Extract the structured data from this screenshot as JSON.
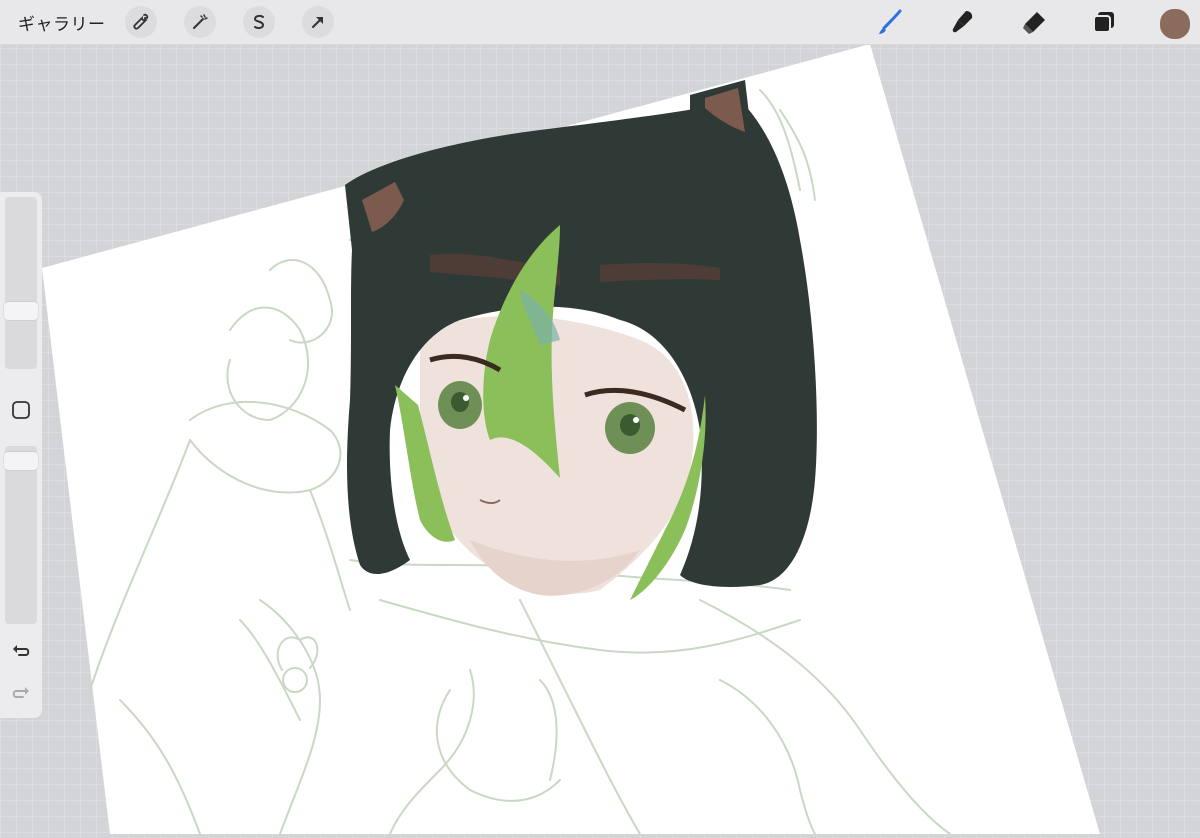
{
  "topbar": {
    "gallery_label": "ギャラリー",
    "left_tools": [
      "wrench-icon",
      "magic-wand-icon",
      "selection-s-icon",
      "arrow-transform-icon"
    ],
    "right_tools": [
      "brush-icon",
      "smudge-icon",
      "eraser-icon",
      "layers-icon"
    ],
    "accent": "#2f6fe0",
    "current_color": "#8b6b5c"
  },
  "sidebar": {
    "brush_size_level": 0.78,
    "opacity_level": 0.05,
    "modify_button": "square-icon",
    "undo": "undo-icon",
    "redo": "redo-icon"
  },
  "canvas": {
    "paper_color": "#ffffff",
    "hair_color": "#2f3a36",
    "highlight_color": "#8bbf5a",
    "skin_color": "#efe2dc",
    "sketch_color": "#c9d8c4"
  }
}
